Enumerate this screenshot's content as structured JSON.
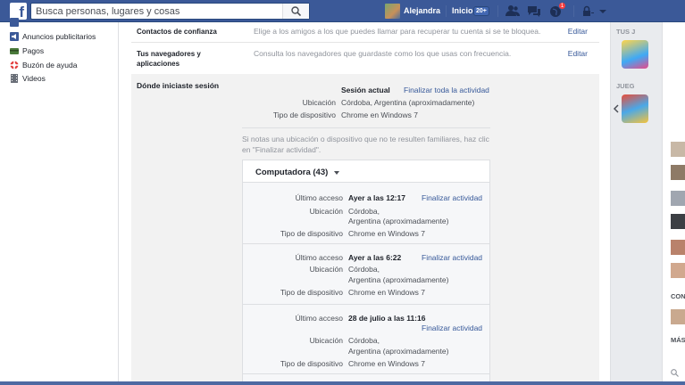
{
  "topbar": {
    "logo": "f",
    "search_placeholder": "Busca personas, lugares y cosas",
    "user_name": "Alejandra",
    "home_label": "Inicio",
    "home_count": "20+",
    "notifications_count": "1"
  },
  "leftnav": {
    "items": [
      {
        "label": "Anuncios publicitarios",
        "icon": "megaphone-icon",
        "color": "#3b5998"
      },
      {
        "label": "Pagos",
        "icon": "payments-icon",
        "color": "#4a7a3a"
      },
      {
        "label": "Buzón de ayuda",
        "icon": "lifebuoy-icon",
        "color": "#e23b3b"
      },
      {
        "label": "Videos",
        "icon": "film-icon",
        "color": "#6a6f78"
      }
    ]
  },
  "settings": {
    "trusted_contacts": {
      "title": "Contactos de confianza",
      "desc": "Elige a los amigos a los que puedes llamar para recuperar tu cuenta si se te bloquea.",
      "edit": "Editar"
    },
    "browsers": {
      "title": "Tus navegadores y aplicaciones",
      "desc": "Consulta los navegadores que guardaste como los que usas con frecuencia.",
      "edit": "Editar"
    },
    "sessions": {
      "title": "Dónde iniciaste sesión",
      "current_header": "Sesión actual",
      "end_all": "Finalizar toda la actividad",
      "location_label": "Ubicación",
      "location_value": "Córdoba, Argentina (aproximadamente)",
      "device_label": "Tipo de dispositivo",
      "device_value": "Chrome en Windows 7",
      "notice": "Si notas una ubicación o dispositivo que no te resulten familiares, haz clic en \"Finalizar actividad\".",
      "computers_header": "Computadora (43)",
      "entries": [
        {
          "last_access_label": "Último acceso",
          "last_access": "Ayer a las 12:17",
          "end": "Finalizar actividad",
          "location_label": "Ubicación",
          "location_line1": "Córdoba,",
          "location_line2": "Argentina (aproximadamente)",
          "device_label": "Tipo de dispositivo",
          "device": "Chrome en Windows 7"
        },
        {
          "last_access_label": "Último acceso",
          "last_access": "Ayer a las 6:22",
          "end": "Finalizar actividad",
          "location_label": "Ubicación",
          "location_line1": "Córdoba,",
          "location_line2": "Argentina (aproximadamente)",
          "device_label": "Tipo de dispositivo",
          "device": "Chrome en Windows 7"
        },
        {
          "last_access_label": "Último acceso",
          "last_access": "28 de julio a las 11:16",
          "end": "Finalizar actividad",
          "location_label": "Ubicación",
          "location_line1": "Córdoba,",
          "location_line2": "Argentina (aproximadamente)",
          "device_label": "Tipo de dispositivo",
          "device": "Chrome en Windows 7"
        }
      ]
    }
  },
  "rightcol": {
    "heading1": "TUS J",
    "heading2": "JUEG",
    "chat_heading1": "CON",
    "chat_heading2": "MÁS"
  }
}
